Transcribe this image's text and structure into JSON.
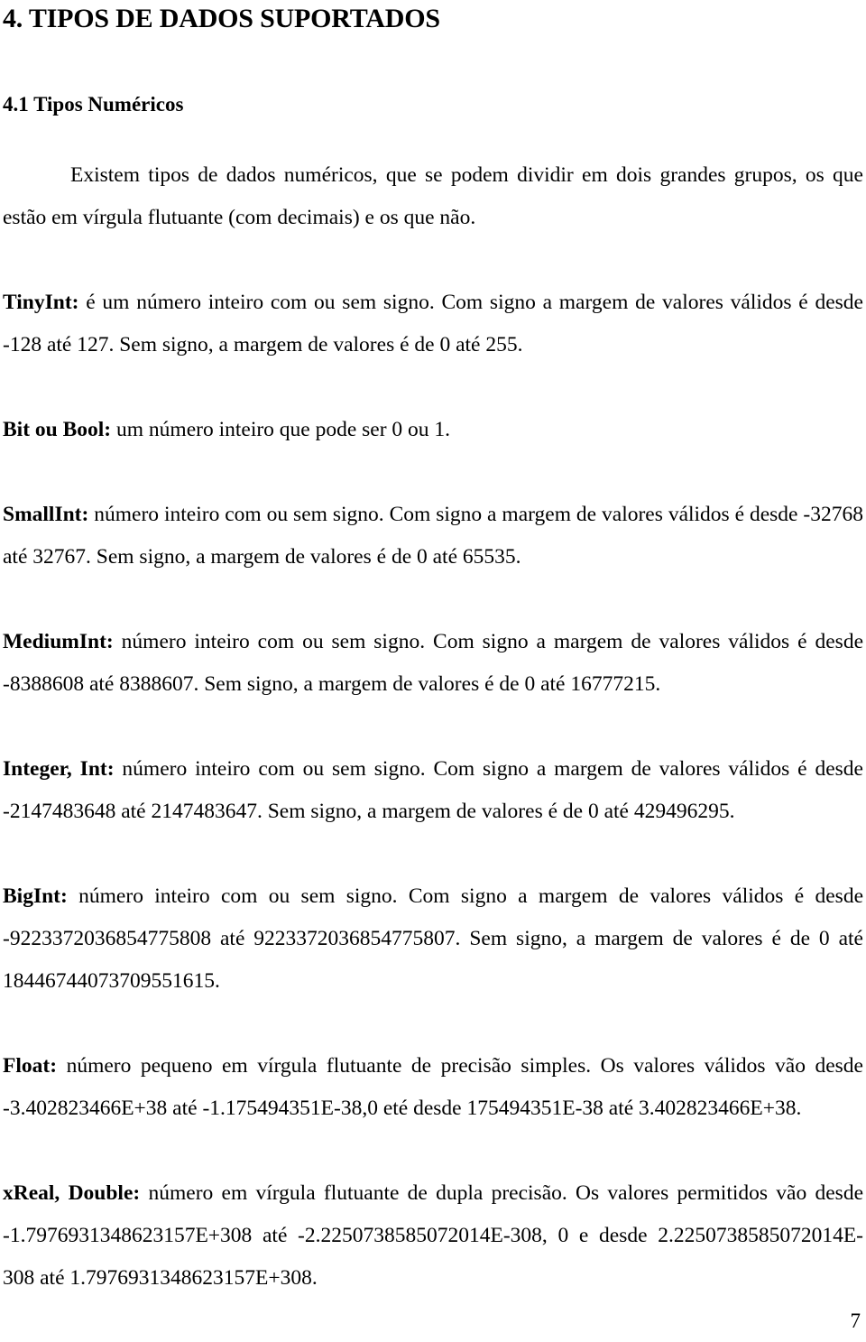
{
  "document": {
    "heading": "4. TIPOS DE DADOS SUPORTADOS",
    "subheading": "4.1 Tipos Numéricos",
    "page_number": "7",
    "intro_paragraph": "Existem tipos de dados numéricos, que se podem dividir em dois grandes grupos, os que estão em vírgula flutuante (com decimais) e os que não.",
    "types": [
      {
        "term": "TinyInt:",
        "description": " é um número inteiro com ou sem signo. Com signo a margem de valores válidos é desde -128 até 127. Sem signo, a margem de valores é de 0 até 255."
      },
      {
        "term": "Bit ou Bool:",
        "description": " um número inteiro que pode ser 0 ou 1."
      },
      {
        "term": "SmallInt:",
        "description": " número inteiro com ou sem signo. Com signo a margem de valores válidos é desde -32768 até 32767. Sem signo, a margem de valores é de 0 até 65535."
      },
      {
        "term": "MediumInt:",
        "description": " número inteiro com ou sem signo. Com signo a margem de valores válidos é desde -8388608 até 8388607. Sem signo, a margem de valores é de 0 até 16777215."
      },
      {
        "term": "Integer, Int:",
        "description": " número inteiro com ou sem signo. Com signo a margem de valores válidos é desde -2147483648 até 2147483647. Sem signo, a margem de valores é de 0 até 429496295."
      },
      {
        "term": "BigInt:",
        "description": " número inteiro com ou sem signo. Com signo a margem de valores válidos é desde -9223372036854775808 até 9223372036854775807. Sem signo, a margem de valores é de 0 até 18446744073709551615."
      },
      {
        "term": "Float:",
        "description": " número pequeno em vírgula flutuante de precisão simples. Os valores válidos vão desde -3.402823466E+38 até -1.175494351E-38,0 eté desde 175494351E-38 até 3.402823466E+38."
      },
      {
        "term": "xReal, Double:",
        "description": " número em vírgula flutuante de dupla precisão. Os valores permitidos vão desde -1.7976931348623157E+308 até -2.2250738585072014E-308, 0 e desde 2.2250738585072014E-308 até 1.7976931348623157E+308."
      }
    ]
  }
}
